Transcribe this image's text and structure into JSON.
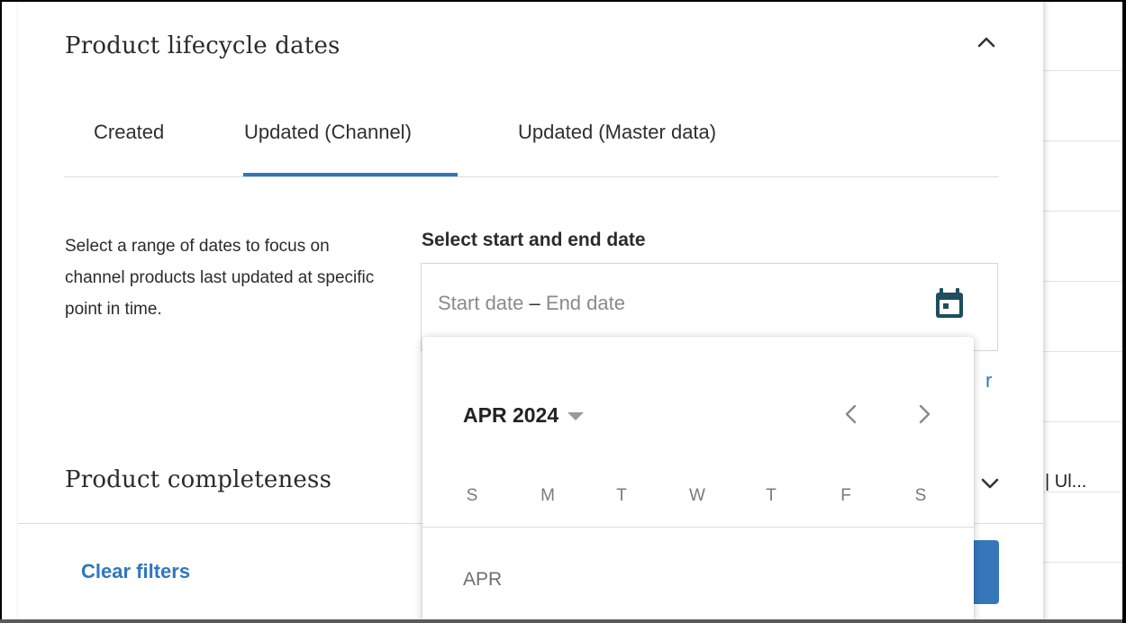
{
  "panel": {
    "section_lifecycle": {
      "title": "Product lifecycle dates"
    },
    "tabs": [
      {
        "label": "Created"
      },
      {
        "label": "Updated (Channel)"
      },
      {
        "label": "Updated (Master data)"
      }
    ],
    "active_tab": "Updated (Channel)",
    "description": "Select a range of dates to focus on channel products last updated at specific point in time.",
    "date_range": {
      "label": "Select start and end date",
      "start_placeholder": "Start date",
      "separator": "–",
      "end_placeholder": "End date"
    },
    "link_fragment": "r",
    "section_completeness": {
      "title": "Product completeness"
    },
    "footer": {
      "clear_filters_label": "Clear filters"
    }
  },
  "calendar": {
    "month_year": "APR 2024",
    "weekdays": [
      "S",
      "M",
      "T",
      "W",
      "T",
      "F",
      "S"
    ],
    "month_label": "APR"
  },
  "background": {
    "cell_text": "| Ul..."
  },
  "colors": {
    "accent": "#2f77bd",
    "primary_button": "#3677bb",
    "text": "#2b2b2b",
    "muted": "#8a8a8a"
  }
}
